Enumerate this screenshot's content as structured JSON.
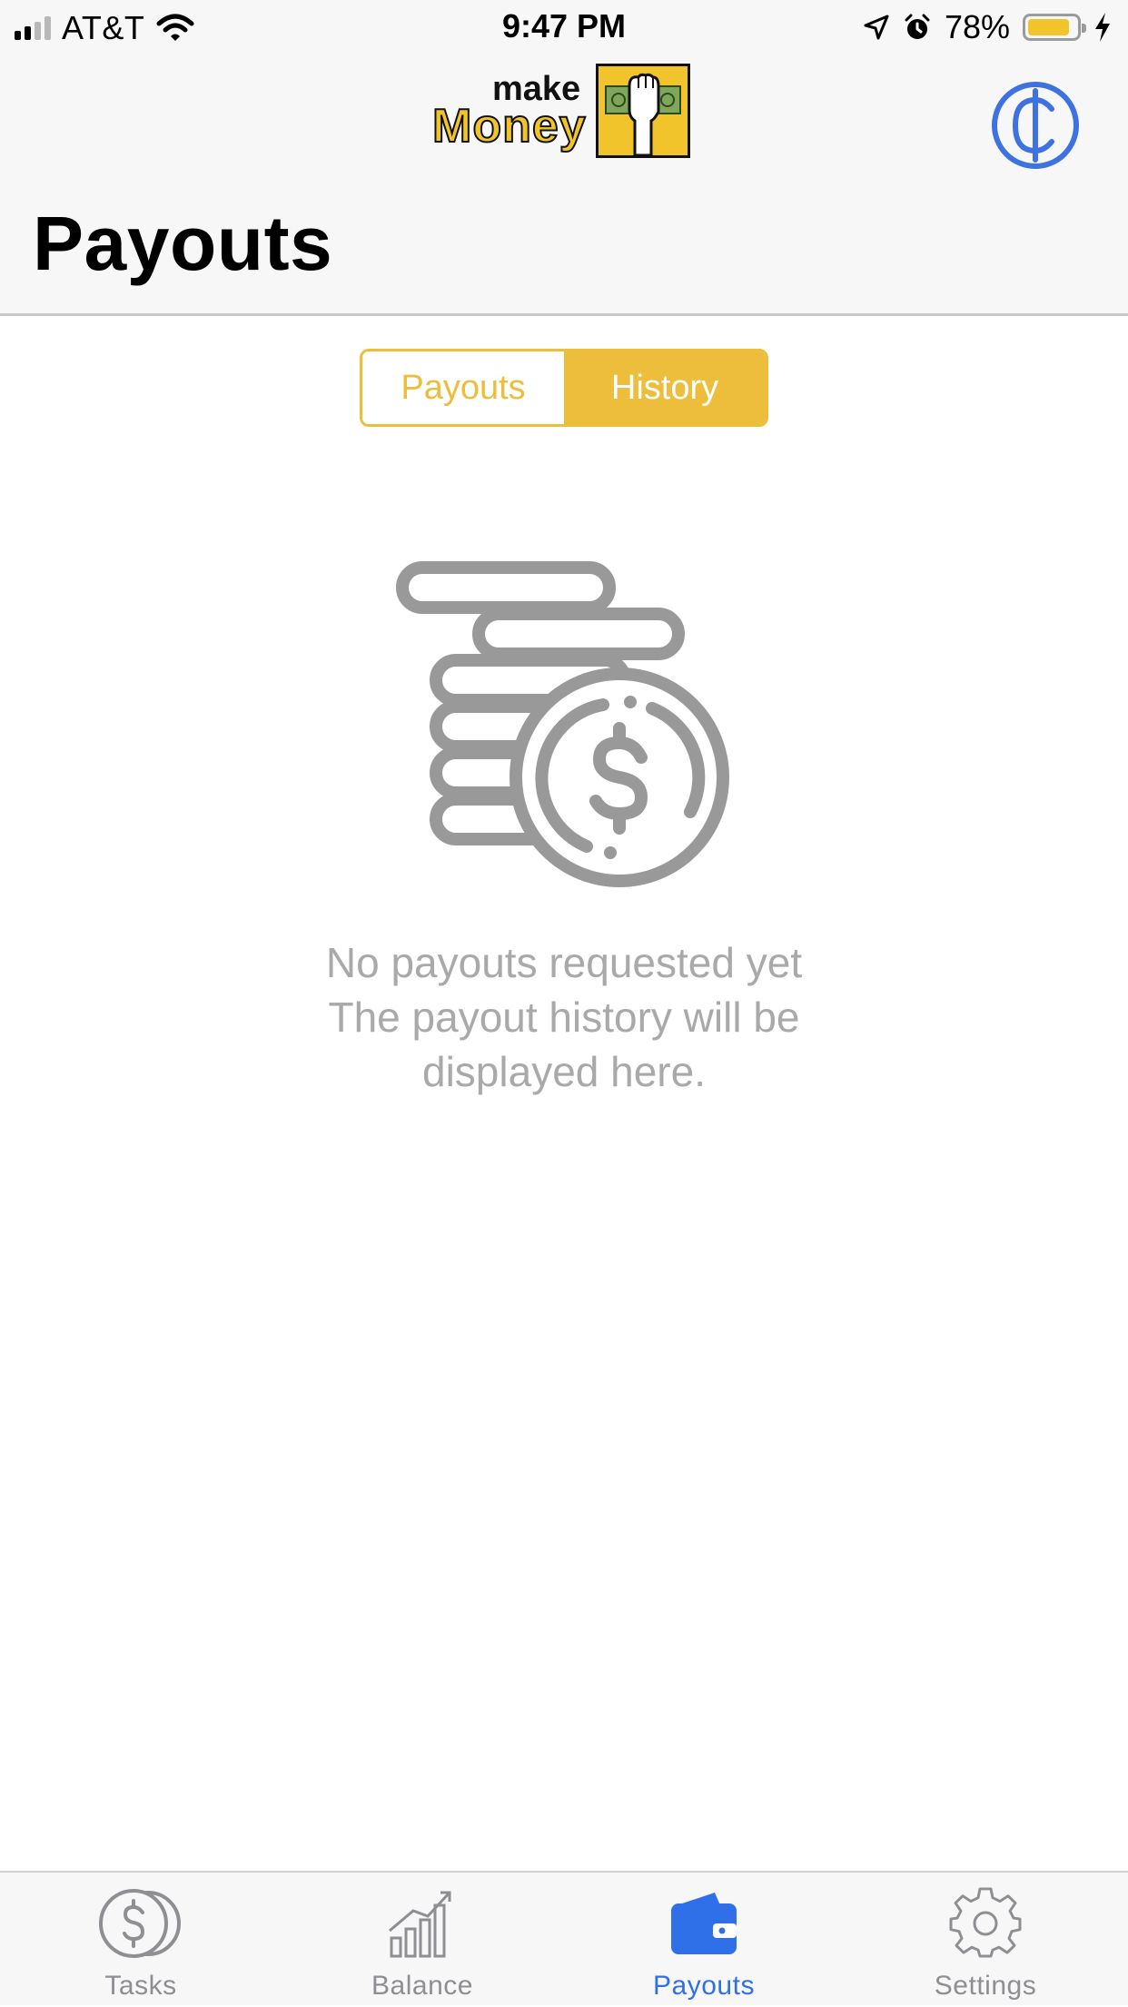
{
  "status_bar": {
    "carrier": "AT&T",
    "time": "9:47 PM",
    "battery_percent": "78%",
    "battery_level": 0.78,
    "icons": [
      "signal-icon",
      "wifi-icon",
      "location-arrow-icon",
      "alarm-icon",
      "battery-icon",
      "charging-bolt-icon"
    ]
  },
  "header": {
    "logo": {
      "line1": "make",
      "line2": "Money"
    },
    "title": "Payouts",
    "currency_icon": "cedi-sign-icon"
  },
  "segmented_control": {
    "options": [
      {
        "label": "Payouts",
        "selected": false
      },
      {
        "label": "History",
        "selected": true
      }
    ]
  },
  "empty_state": {
    "icon": "coin-stack-icon",
    "line1": "No payouts requested yet",
    "line2": "The payout history will be",
    "line3": "displayed here."
  },
  "tab_bar": {
    "items": [
      {
        "label": "Tasks",
        "icon": "coins-icon",
        "active": false
      },
      {
        "label": "Balance",
        "icon": "bar-chart-icon",
        "active": false
      },
      {
        "label": "Payouts",
        "icon": "wallet-icon",
        "active": true
      },
      {
        "label": "Settings",
        "icon": "gear-icon",
        "active": false
      }
    ]
  },
  "colors": {
    "accent_yellow": "#ecbe3c",
    "active_blue": "#2f6fe8",
    "inactive_gray": "#8e8e93",
    "empty_text_gray": "#a9a9a9",
    "illustration_gray": "#999999"
  }
}
